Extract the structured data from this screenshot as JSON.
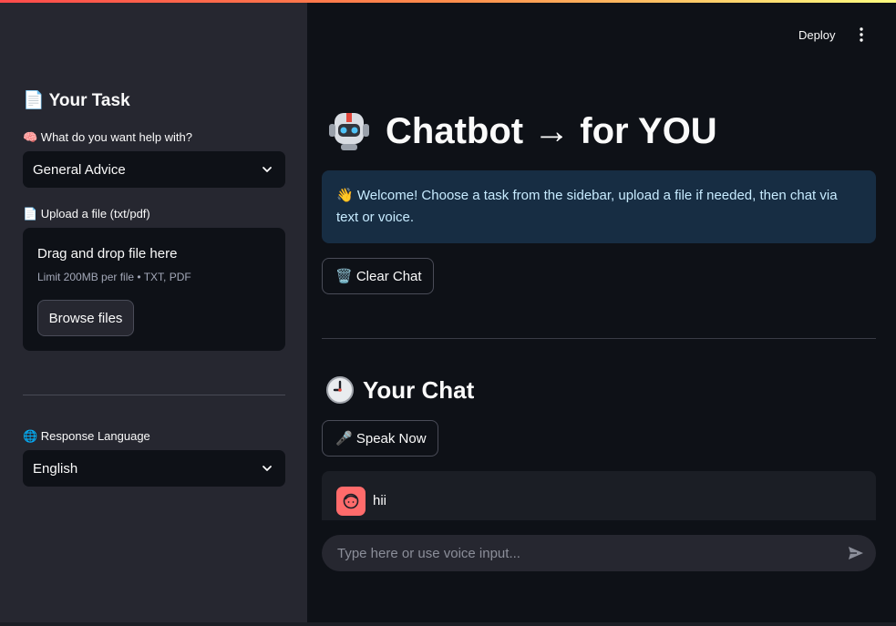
{
  "sidebar": {
    "task_title": "📄 Your Task",
    "help_label": "🧠 What do you want help with?",
    "help_value": "General Advice",
    "upload_label": "📄 Upload a file (txt/pdf)",
    "upload_title": "Drag and drop file here",
    "upload_limit": "Limit 200MB per file • TXT, PDF",
    "browse_label": "Browse files",
    "language_label": "🌐 Response Language",
    "language_value": "English"
  },
  "header": {
    "deploy_label": "Deploy",
    "menu_icon": "kebab-menu-icon"
  },
  "main": {
    "title": "Chatbot → for YOU",
    "title_icon": "robot-icon",
    "info": "👋 Welcome! Choose a task from the sidebar, upload a file if needed, then chat via text or voice.",
    "clear_label": "🗑️ Clear Chat",
    "chat_title": "Your Chat",
    "chat_icon": "clock-icon",
    "speak_label": "🎤 Speak Now",
    "messages": [
      {
        "role": "user",
        "text": "hii"
      }
    ],
    "input_placeholder": "Type here or use voice input..."
  },
  "colors": {
    "sidebar_bg": "#262730",
    "main_bg": "#0e1117",
    "info_bg": "#172d43",
    "info_text": "#c7ebff",
    "user_avatar": "#ff6b6b",
    "accent": "#ff4b4b"
  }
}
